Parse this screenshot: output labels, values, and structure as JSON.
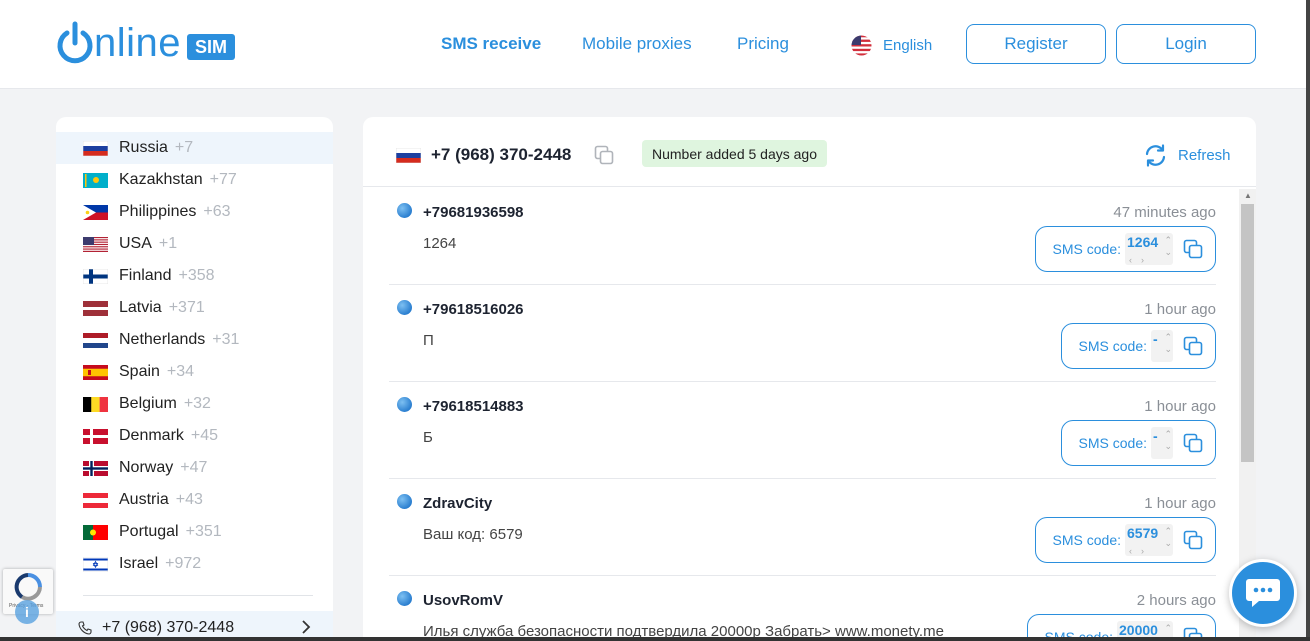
{
  "header": {
    "logo_text": "nline",
    "logo_badge": "SIM",
    "nav": [
      {
        "label": "SMS receive",
        "active": true
      },
      {
        "label": "Mobile proxies",
        "active": false
      },
      {
        "label": "Pricing",
        "active": false
      }
    ],
    "language": "English",
    "language_icon": "us-flag-icon",
    "register_label": "Register",
    "login_label": "Login"
  },
  "sidebar": {
    "countries": [
      {
        "name": "Russia",
        "code": "+7",
        "flag": "russia-flag-icon",
        "active": true
      },
      {
        "name": "Kazakhstan",
        "code": "+77",
        "flag": "kazakhstan-flag-icon"
      },
      {
        "name": "Philippines",
        "code": "+63",
        "flag": "philippines-flag-icon"
      },
      {
        "name": "USA",
        "code": "+1",
        "flag": "usa-flag-icon"
      },
      {
        "name": "Finland",
        "code": "+358",
        "flag": "finland-flag-icon"
      },
      {
        "name": "Latvia",
        "code": "+371",
        "flag": "latvia-flag-icon"
      },
      {
        "name": "Netherlands",
        "code": "+31",
        "flag": "netherlands-flag-icon"
      },
      {
        "name": "Spain",
        "code": "+34",
        "flag": "spain-flag-icon"
      },
      {
        "name": "Belgium",
        "code": "+32",
        "flag": "belgium-flag-icon"
      },
      {
        "name": "Denmark",
        "code": "+45",
        "flag": "denmark-flag-icon"
      },
      {
        "name": "Norway",
        "code": "+47",
        "flag": "norway-flag-icon"
      },
      {
        "name": "Austria",
        "code": "+43",
        "flag": "austria-flag-icon"
      },
      {
        "name": "Portugal",
        "code": "+351",
        "flag": "portugal-flag-icon"
      },
      {
        "name": "Israel",
        "code": "+972",
        "flag": "israel-flag-icon"
      }
    ],
    "selected_number": "+7 (968) 370-2448"
  },
  "main": {
    "number": "+7 (968) 370-2448",
    "added_badge": "Number added 5 days ago",
    "refresh_label": "Refresh",
    "code_label": "SMS code:",
    "messages": [
      {
        "sender": "+79681936598",
        "text": "1264",
        "time": "47 minutes ago",
        "code": "1264"
      },
      {
        "sender": "+79618516026",
        "text": "П",
        "time": "1 hour ago",
        "code": "-"
      },
      {
        "sender": "+79618514883",
        "text": "Б",
        "time": "1 hour ago",
        "code": "-"
      },
      {
        "sender": "ZdravCity",
        "text": "Ваш код: 6579",
        "time": "1 hour ago",
        "code": "6579"
      },
      {
        "sender": "UsovRomV",
        "text": "Илья служба безопасности подтвердила 20000р Забрать> www.monety.me",
        "time": "2 hours ago",
        "code": "20000"
      }
    ]
  },
  "widgets": {
    "recaptcha_text": "Privacy - Terms",
    "chat_icon": "chat-bubble-icon"
  },
  "colors": {
    "accent": "#2b8fdd",
    "badge_bg": "#dff5df",
    "muted": "#b3b8bf"
  }
}
